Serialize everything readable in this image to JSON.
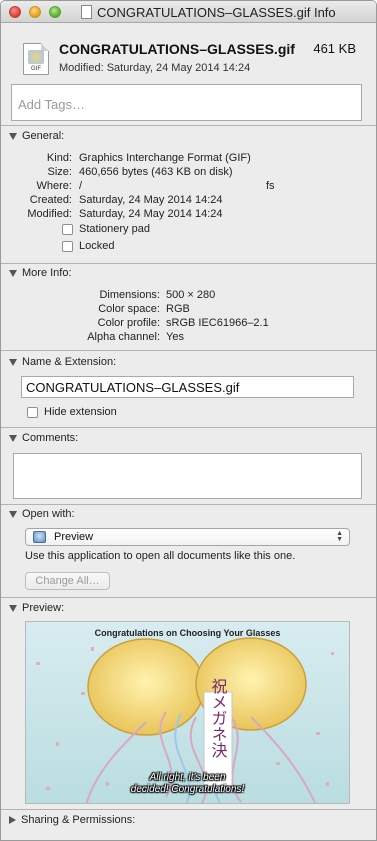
{
  "window": {
    "title": "CONGRATULATIONS–GLASSES.gif Info"
  },
  "header": {
    "file_name": "CONGRATULATIONS–GLASSES.gif",
    "file_size": "461 KB",
    "modified": "Modified: Saturday, 24 May 2014 14:24",
    "icon_ext": "GIF",
    "tags_placeholder": "Add Tags…"
  },
  "general": {
    "title": "General:",
    "rows": [
      {
        "label": "Kind:",
        "value": "Graphics Interchange Format (GIF)"
      },
      {
        "label": "Size:",
        "value": "460,656 bytes (463 KB on disk)"
      },
      {
        "label": "Where:",
        "value": "/",
        "value_suffix": "fs"
      },
      {
        "label": "Created:",
        "value": "Saturday, 24 May 2014 14:24"
      },
      {
        "label": "Modified:",
        "value": "Saturday, 24 May 2014 14:24"
      }
    ],
    "stationery_label": "Stationery pad",
    "locked_label": "Locked"
  },
  "more_info": {
    "title": "More Info:",
    "rows": [
      {
        "label": "Dimensions:",
        "value": "500 × 280"
      },
      {
        "label": "Color space:",
        "value": "RGB"
      },
      {
        "label": "Color profile:",
        "value": "sRGB IEC61966–2.1"
      },
      {
        "label": "Alpha channel:",
        "value": "Yes"
      }
    ]
  },
  "name_extension": {
    "title": "Name & Extension:",
    "value": "CONGRATULATIONS–GLASSES.gif",
    "hide_extension_label": "Hide extension"
  },
  "comments": {
    "title": "Comments:",
    "value": ""
  },
  "open_with": {
    "title": "Open with:",
    "app": "Preview",
    "description": "Use this application to open all documents like this one.",
    "change_all_label": "Change All…"
  },
  "preview": {
    "title": "Preview:",
    "caption_top": "Congratulations on Choosing Your Glasses",
    "banner_text": "祝メガネ決",
    "subtitle_line1": "All right, it's been",
    "subtitle_line2": "decided! Congratulations!"
  },
  "sharing": {
    "title": "Sharing & Permissions:"
  },
  "colors": {
    "window_bg": "#ececec",
    "divider": "#b3b3b3"
  }
}
